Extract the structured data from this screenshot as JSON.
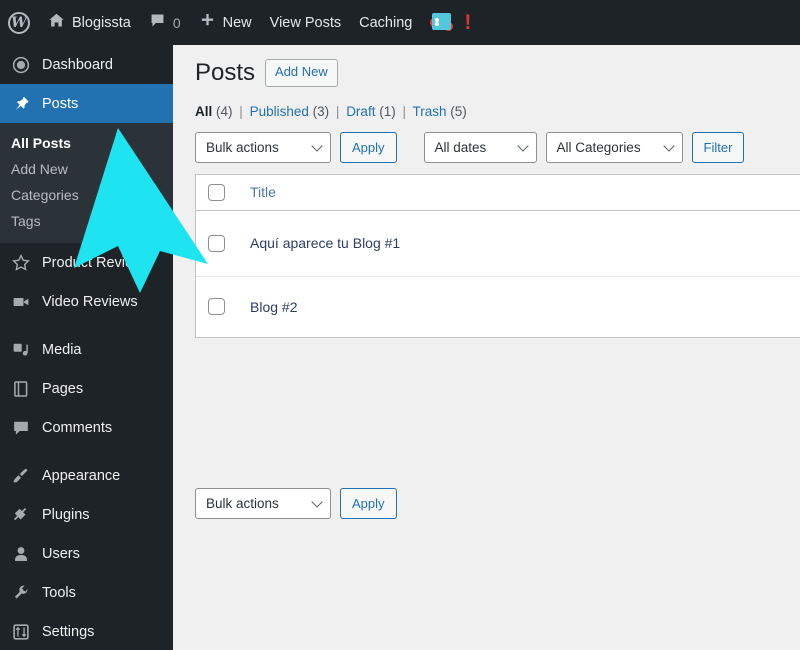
{
  "adminbar": {
    "logo_icon": "wordpress-logo-icon",
    "home_icon": "home-icon",
    "site_name": "Blogissta",
    "comments_icon": "comment-bubble-icon",
    "comment_count": "0",
    "new_icon": "plus-icon",
    "new_label": "New",
    "view_posts_label": "View Posts",
    "caching_label": "Caching",
    "plugin_icon": "plugin-notice-icon",
    "alert_glyph": "!"
  },
  "sidebar": {
    "items": [
      {
        "label": "Dashboard",
        "icon": "dashboard-icon",
        "key": "dashboard"
      },
      {
        "label": "Posts",
        "icon": "pin-icon",
        "key": "posts",
        "active": true
      },
      {
        "label": "Product Reviews",
        "icon": "star-icon",
        "key": "product-reviews"
      },
      {
        "label": "Video Reviews",
        "icon": "video-camera-icon",
        "key": "video-reviews"
      },
      {
        "label": "Media",
        "icon": "media-icon",
        "key": "media"
      },
      {
        "label": "Pages",
        "icon": "page-icon",
        "key": "pages"
      },
      {
        "label": "Comments",
        "icon": "comment-bubble-icon",
        "key": "comments"
      },
      {
        "label": "Appearance",
        "icon": "paintbrush-icon",
        "key": "appearance"
      },
      {
        "label": "Plugins",
        "icon": "plug-icon",
        "key": "plugins"
      },
      {
        "label": "Users",
        "icon": "user-icon",
        "key": "users"
      },
      {
        "label": "Tools",
        "icon": "wrench-icon",
        "key": "tools"
      },
      {
        "label": "Settings",
        "icon": "sliders-icon",
        "key": "settings"
      }
    ],
    "submenu": [
      {
        "label": "All Posts",
        "current": true
      },
      {
        "label": "Add New",
        "current": false
      },
      {
        "label": "Categories",
        "current": false
      },
      {
        "label": "Tags",
        "current": false
      }
    ]
  },
  "page": {
    "title": "Posts",
    "add_new_label": "Add New"
  },
  "status_links": [
    {
      "label": "All",
      "count": "(4)",
      "current": true
    },
    {
      "label": "Published",
      "count": "(3)",
      "current": false
    },
    {
      "label": "Draft",
      "count": "(1)",
      "current": false
    },
    {
      "label": "Trash",
      "count": "(5)",
      "current": false
    }
  ],
  "separator": "|",
  "toolbar_top": {
    "bulk_actions_value": "Bulk actions",
    "apply_label": "Apply",
    "dates_value": "All dates",
    "categories_value": "All Categories",
    "filter_label": "Filter"
  },
  "toolbar_bottom": {
    "bulk_actions_value": "Bulk actions",
    "apply_label": "Apply"
  },
  "table": {
    "column_title": "Title",
    "rows": [
      {
        "title": "Aquí  aparece tu Blog #1"
      },
      {
        "title": "Blog #2"
      }
    ]
  },
  "overlay": {
    "cursor_icon": "arrow-cursor-pointer",
    "cursor_color": "#1ee3f0"
  },
  "colors": {
    "sidebar_bg": "#1d2327",
    "submenu_bg": "#2c3338",
    "active_blue": "#2271b1",
    "page_bg": "#f0f0f1",
    "link_blue": "#2271b1"
  }
}
